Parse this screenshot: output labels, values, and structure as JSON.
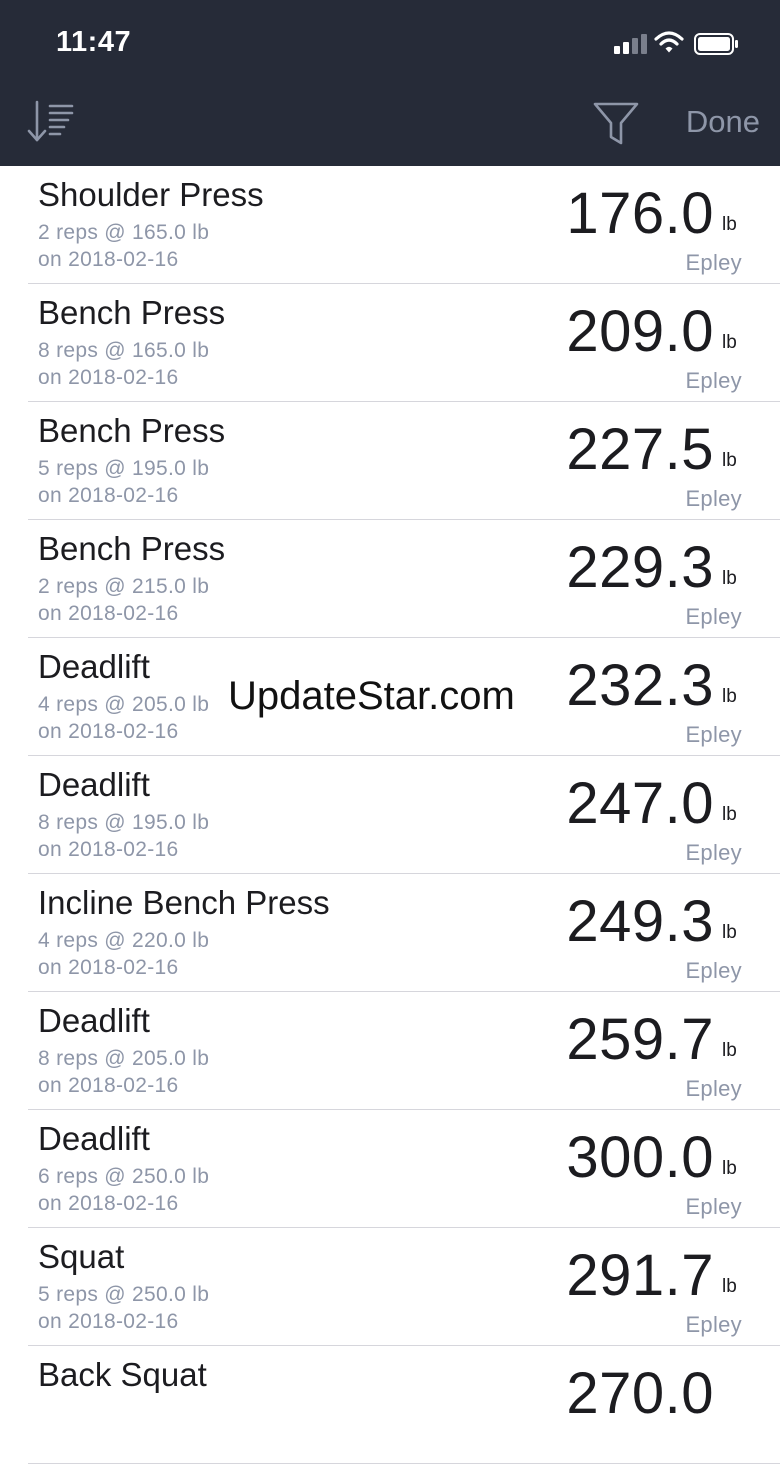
{
  "status_bar": {
    "time": "11:47"
  },
  "toolbar": {
    "sort_icon": "sort-descending-icon",
    "filter_icon": "filter-icon",
    "done_label": "Done",
    "bar_color": "#262b38",
    "accent_color": "#8e96a8"
  },
  "rows": [
    {
      "name": "Shoulder Press",
      "detail": "2 reps @ 165.0 lb",
      "date": "on 2018-02-16",
      "value": "176.0",
      "unit": "lb",
      "formula": "Epley"
    },
    {
      "name": "Bench Press",
      "detail": "8 reps @ 165.0 lb",
      "date": "on 2018-02-16",
      "value": "209.0",
      "unit": "lb",
      "formula": "Epley"
    },
    {
      "name": "Bench Press",
      "detail": "5 reps @ 195.0 lb",
      "date": "on 2018-02-16",
      "value": "227.5",
      "unit": "lb",
      "formula": "Epley"
    },
    {
      "name": "Bench Press",
      "detail": "2 reps @ 215.0 lb",
      "date": "on 2018-02-16",
      "value": "229.3",
      "unit": "lb",
      "formula": "Epley"
    },
    {
      "name": "Deadlift",
      "detail": "4 reps @ 205.0 lb",
      "date": "on 2018-02-16",
      "value": "232.3",
      "unit": "lb",
      "formula": "Epley"
    },
    {
      "name": "Deadlift",
      "detail": "8 reps @ 195.0 lb",
      "date": "on 2018-02-16",
      "value": "247.0",
      "unit": "lb",
      "formula": "Epley"
    },
    {
      "name": "Incline Bench Press",
      "detail": "4 reps @ 220.0 lb",
      "date": "on 2018-02-16",
      "value": "249.3",
      "unit": "lb",
      "formula": "Epley"
    },
    {
      "name": "Deadlift",
      "detail": "8 reps @ 205.0 lb",
      "date": "on 2018-02-16",
      "value": "259.7",
      "unit": "lb",
      "formula": "Epley"
    },
    {
      "name": "Deadlift",
      "detail": "6 reps @ 250.0 lb",
      "date": "on 2018-02-16",
      "value": "300.0",
      "unit": "lb",
      "formula": "Epley"
    },
    {
      "name": "Squat",
      "detail": "5 reps @ 250.0 lb",
      "date": "on 2018-02-16",
      "value": "291.7",
      "unit": "lb",
      "formula": "Epley"
    },
    {
      "name": "Back Squat",
      "detail": "",
      "date": "",
      "value": "270.0",
      "unit": "",
      "formula": ""
    }
  ],
  "watermark": "UpdateStar.com"
}
